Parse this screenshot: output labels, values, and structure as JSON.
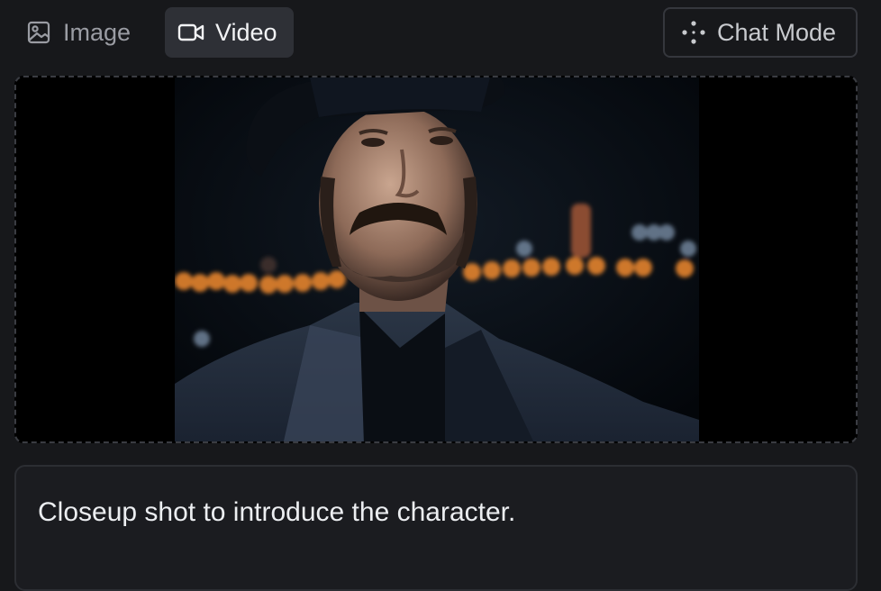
{
  "tabs": [
    {
      "label": "Image",
      "icon": "image-icon",
      "active": false
    },
    {
      "label": "Video",
      "icon": "video-camera-icon",
      "active": true
    }
  ],
  "chat_mode": {
    "label": "Chat Mode",
    "icon": "sparkle-dots-icon"
  },
  "media": {
    "kind": "video-frame"
  },
  "prompt": {
    "text": "Closeup shot to introduce the character."
  },
  "colors": {
    "background": "#17181b",
    "active_tab": "#2e3036",
    "border": "#35373d",
    "text": "#e6e7ea",
    "muted_text": "#9a9ca3",
    "bokeh_orange": "#f08a2e"
  }
}
